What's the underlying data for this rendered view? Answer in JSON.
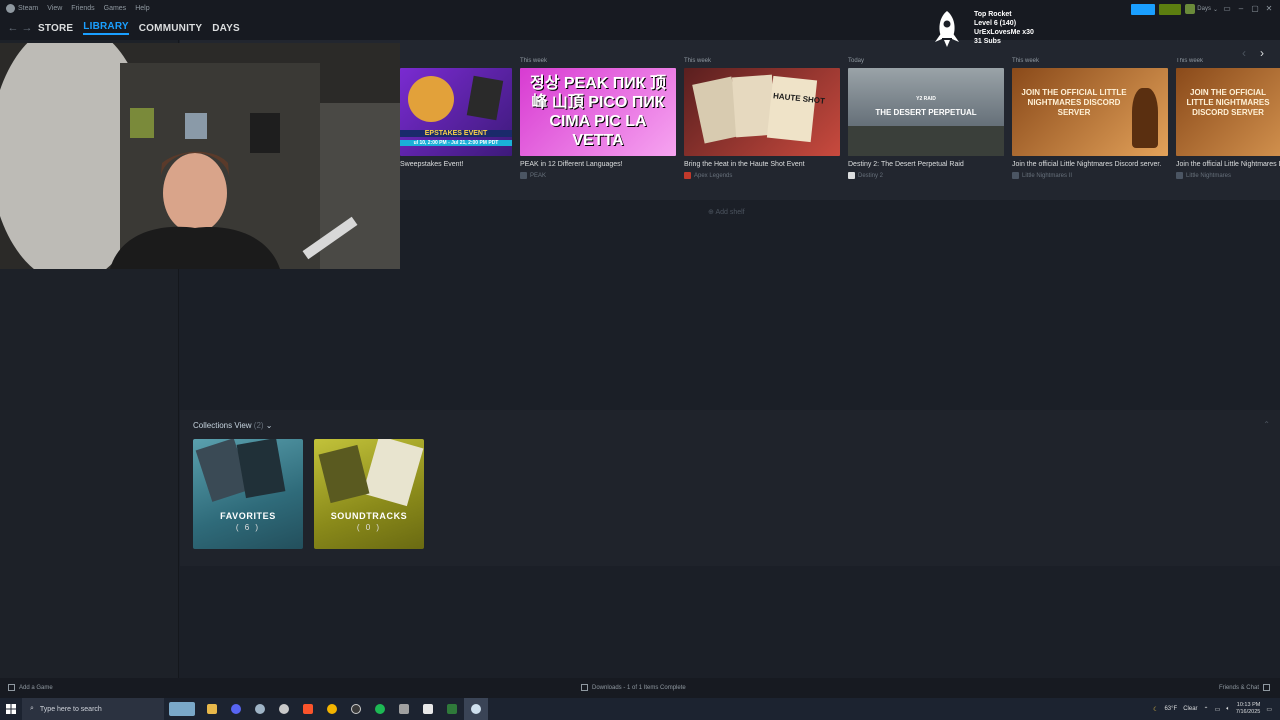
{
  "menubar": {
    "items": [
      "Steam",
      "View",
      "Friends",
      "Games",
      "Help"
    ],
    "user_name": "Days"
  },
  "nav": {
    "tabs": [
      {
        "label": "STORE",
        "active": false
      },
      {
        "label": "LIBRARY",
        "active": true
      },
      {
        "label": "COMMUNITY",
        "active": false
      },
      {
        "label": "DAYS",
        "active": false
      }
    ]
  },
  "overlay": {
    "line1": "Top Rocket",
    "line2": "Level 6  (140)",
    "line3": "UrExLovesMe x30",
    "line4": "31 Subs"
  },
  "news": [
    {
      "when": "",
      "title": "Sweepstakes Event!",
      "game": "",
      "thumb_text": "EPSTAKES EVENT",
      "thumb_sub": "ul 10, 2:00 PM - Jul 21, 2:00 PM PDT",
      "colors": [
        "#7a2bd1",
        "#e2a13a"
      ]
    },
    {
      "when": "This week",
      "title": "PEAK in 12 Different Languages!",
      "game": "PEAK",
      "thumb_text": "정상 PEAK ПИК 顶峰 山頂 PICO ПИК CIMA PIC LA VETTA",
      "colors": [
        "#d83bd2",
        "#f6a4f0"
      ]
    },
    {
      "when": "This week",
      "title": "Bring the Heat in the Haute Shot Event",
      "game": "Apex Legends",
      "thumb_text": "HAUTE SHOT",
      "colors": [
        "#8f2a2a",
        "#c84a3e"
      ]
    },
    {
      "when": "Today",
      "title": "Destiny 2: The Desert Perpetual Raid",
      "game": "Destiny 2",
      "thumb_text": "THE DESERT PERPETUAL",
      "thumb_sub": "Y2 RAID",
      "colors": [
        "#6f7a80",
        "#3c4650"
      ]
    },
    {
      "when": "This week",
      "title": "Join the official Little Nightmares Discord server.",
      "game": "Little Nightmares II",
      "thumb_text": "JOIN THE OFFICIAL LITTLE NIGHTMARES DISCORD SERVER",
      "colors": [
        "#b86a2a",
        "#e3a25a"
      ]
    },
    {
      "when": "This week",
      "title": "Join the official Little Nightmares Discord server.",
      "game": "Little Nightmares",
      "thumb_text": "JOIN THE OFFICIAL LITTLE NIGHTMARES DISCORD SERVER",
      "colors": [
        "#b86a2a",
        "#e3a25a"
      ]
    }
  ],
  "add_shelf": "Add shelf",
  "collections": {
    "label": "Collections View",
    "count": "(2)",
    "tiles": [
      {
        "name": "FAVORITES",
        "count": "( 6 )",
        "color": "#2f6b7a"
      },
      {
        "name": "SOUNDTRACKS",
        "count": "( 0 )",
        "color": "#8a8a1a"
      }
    ]
  },
  "bottombar": {
    "add_game": "Add a Game",
    "downloads": "Downloads - 1 of 1 Items Complete",
    "friends": "Friends & Chat"
  },
  "taskbar": {
    "search_placeholder": "Type here to search",
    "weather_temp": "63°F",
    "weather_cond": "Clear",
    "time": "10:13 PM",
    "date": "7/16/2025"
  }
}
